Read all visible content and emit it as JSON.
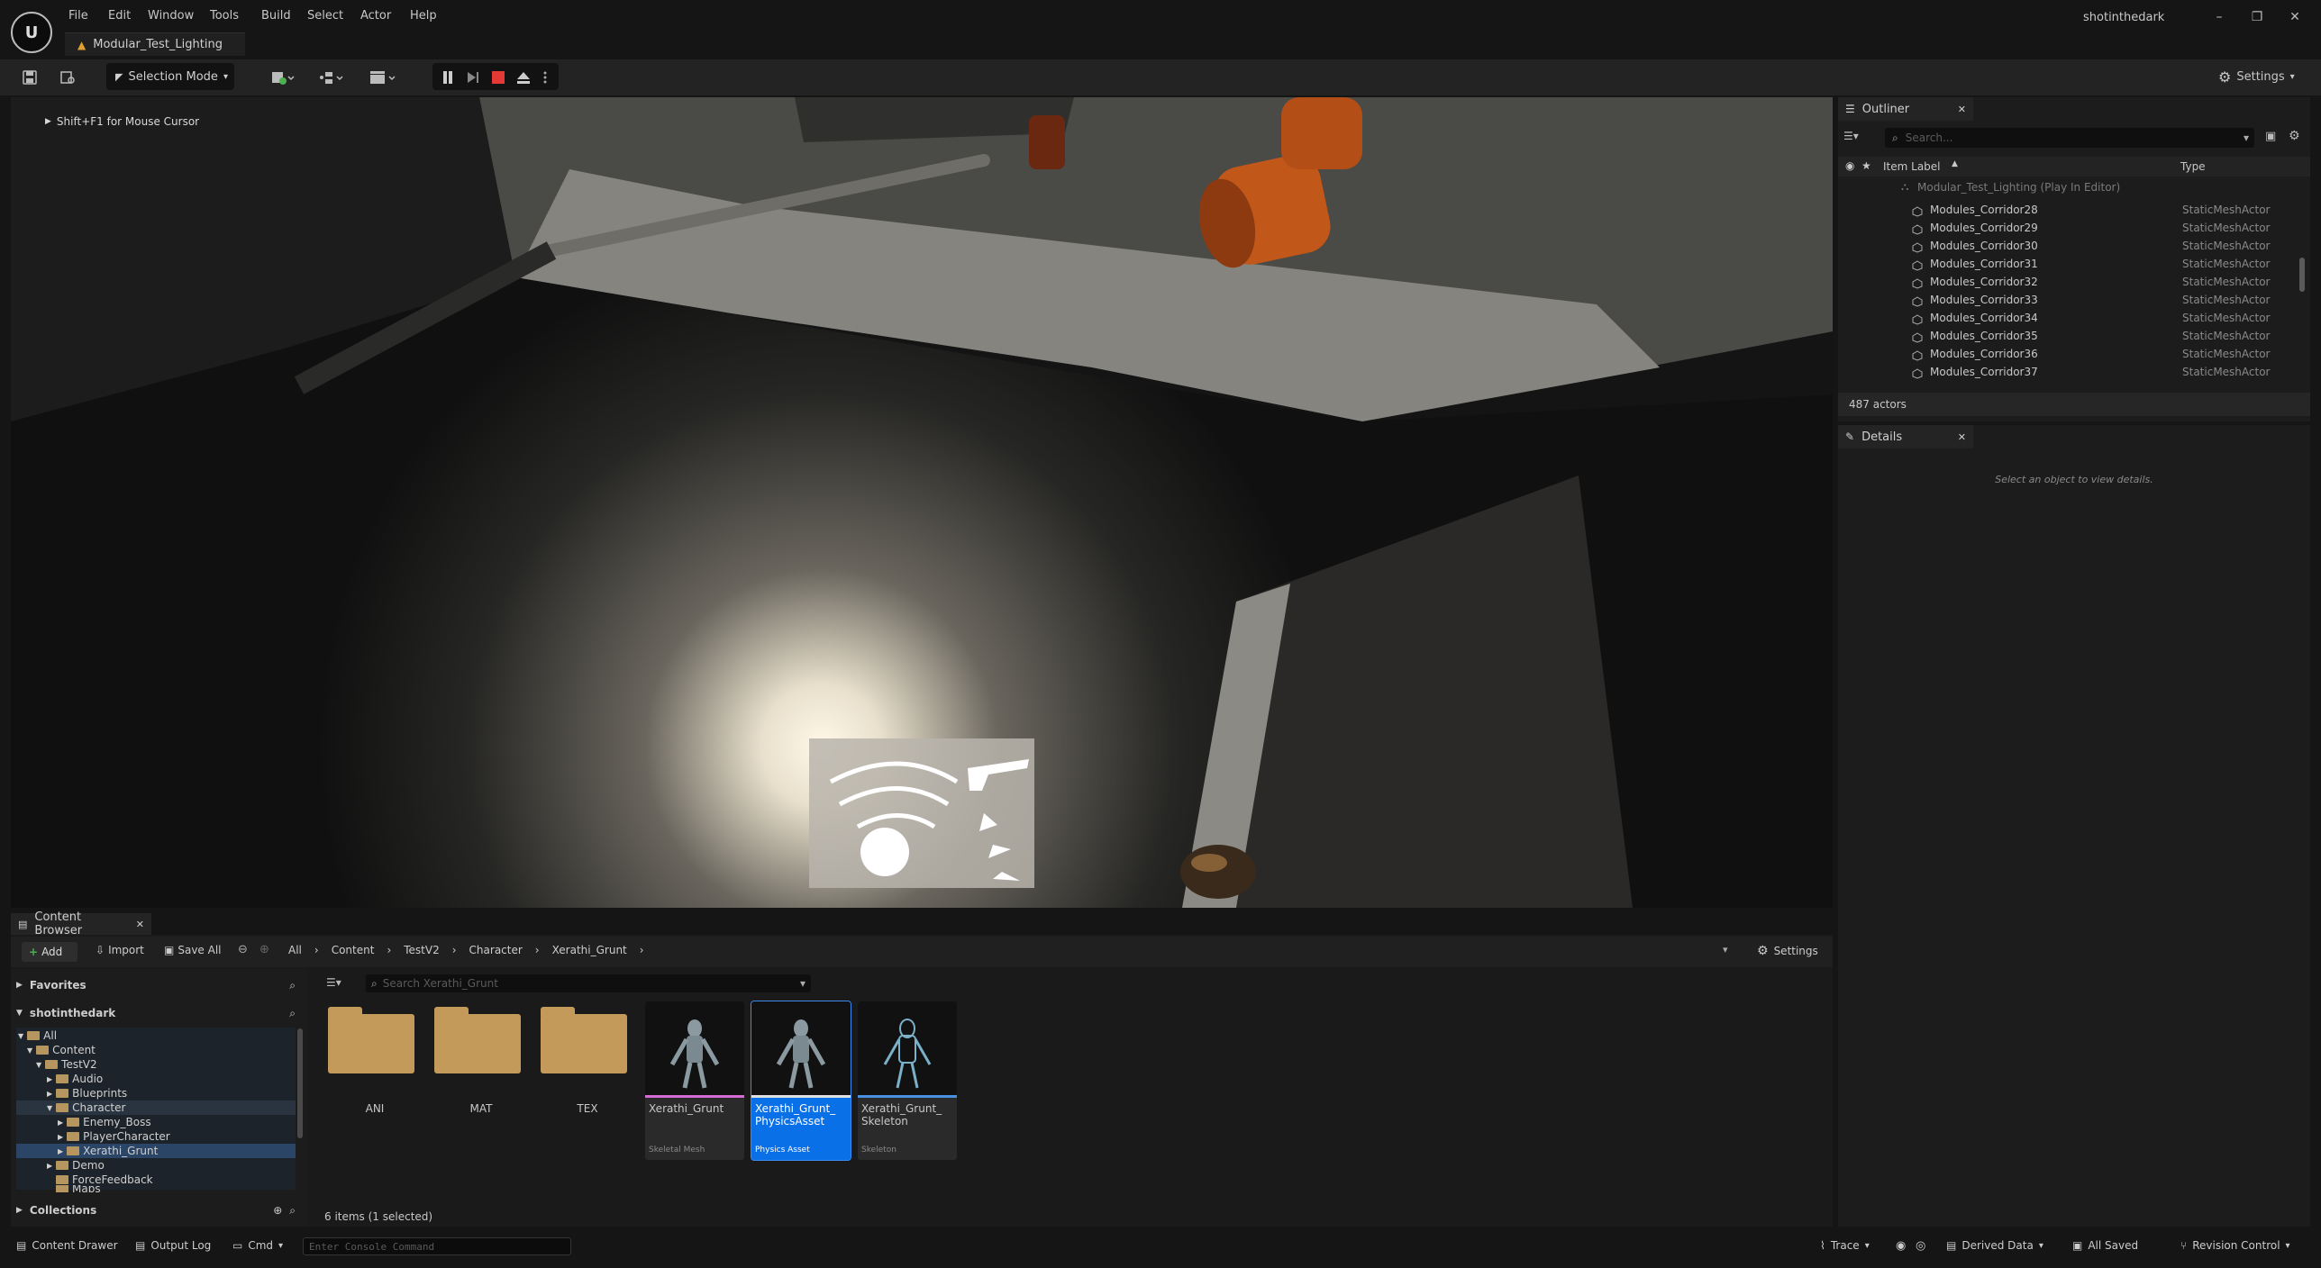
{
  "window": {
    "menu": [
      "File",
      "Edit",
      "Window",
      "Tools",
      "Build",
      "Select",
      "Actor",
      "Help"
    ],
    "doc_tab": "Modular_Test_Lighting",
    "project_name": "shotinthedark"
  },
  "toolbar": {
    "mode_label": "Selection Mode",
    "settings_label": "Settings"
  },
  "viewport": {
    "hint": "Shift+F1 for Mouse Cursor"
  },
  "outliner": {
    "tab_label": "Outliner",
    "search_placeholder": "Search...",
    "col_label": "Item Label",
    "col_type": "Type",
    "level_row": "Modular_Test_Lighting (Play In Editor)",
    "rows": [
      {
        "name": "Modules_Corridor28",
        "type": "StaticMeshActor"
      },
      {
        "name": "Modules_Corridor29",
        "type": "StaticMeshActor"
      },
      {
        "name": "Modules_Corridor30",
        "type": "StaticMeshActor"
      },
      {
        "name": "Modules_Corridor31",
        "type": "StaticMeshActor"
      },
      {
        "name": "Modules_Corridor32",
        "type": "StaticMeshActor"
      },
      {
        "name": "Modules_Corridor33",
        "type": "StaticMeshActor"
      },
      {
        "name": "Modules_Corridor34",
        "type": "StaticMeshActor"
      },
      {
        "name": "Modules_Corridor35",
        "type": "StaticMeshActor"
      },
      {
        "name": "Modules_Corridor36",
        "type": "StaticMeshActor"
      },
      {
        "name": "Modules_Corridor37",
        "type": "StaticMeshActor"
      }
    ],
    "actor_count": "487 actors"
  },
  "details": {
    "tab_label": "Details",
    "empty_text": "Select an object to view details."
  },
  "content_browser": {
    "tab_label": "Content Browser",
    "add_label": "Add",
    "import_label": "Import",
    "save_all_label": "Save All",
    "settings_label": "Settings",
    "breadcrumb": [
      "All",
      "Content",
      "TestV2",
      "Character",
      "Xerathi_Grunt"
    ],
    "favorites_label": "Favorites",
    "project_label": "shotinthedark",
    "collections_label": "Collections",
    "search_placeholder": "Search Xerathi_Grunt",
    "tree": [
      "All",
      "Content",
      "TestV2",
      "Audio",
      "Blueprints",
      "Character",
      "Enemy_Boss",
      "PlayerCharacter",
      "Xerathi_Grunt",
      "Demo",
      "ForceFeedback",
      "Maps"
    ],
    "folders": [
      "ANI",
      "MAT",
      "TEX"
    ],
    "assets": [
      {
        "name": "Xerathi_Grunt",
        "type": "Skeletal Mesh",
        "color": "#d46ad4"
      },
      {
        "name": "Xerathi_Grunt_ PhysicsAsset",
        "type": "Physics Asset",
        "color": "#e0e0e0"
      },
      {
        "name": "Xerathi_Grunt_ Skeleton",
        "type": "Skeleton",
        "color": "#4a90e2"
      }
    ],
    "status": "6 items (1 selected)"
  },
  "statusbar": {
    "content_drawer": "Content Drawer",
    "output_log": "Output Log",
    "cmd": "Cmd",
    "console_placeholder": "Enter Console Command",
    "trace": "Trace",
    "derived_data": "Derived Data",
    "all_saved": "All Saved",
    "revision_control": "Revision Control"
  }
}
